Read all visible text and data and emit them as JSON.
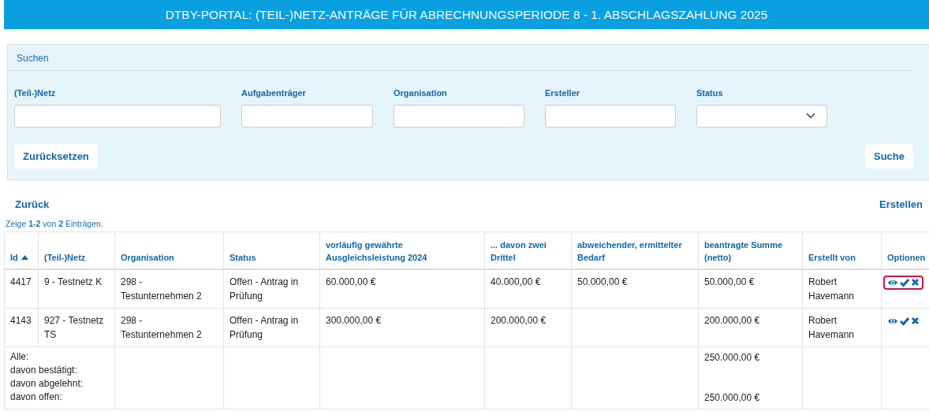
{
  "title": "DTBY-PORTAL: (TEIL-)NETZ-ANTRÄGE FÜR ABRECHNUNGSPERIODE 8 - 1. ABSCHLAGSZAHLUNG 2025",
  "search": {
    "heading": "Suchen",
    "fields": [
      {
        "label": "(Teil-)Netz",
        "dropdown": false
      },
      {
        "label": "Aufgabenträger",
        "dropdown": false
      },
      {
        "label": "Organisation",
        "dropdown": false
      },
      {
        "label": "Ersteller",
        "dropdown": false
      },
      {
        "label": "Status",
        "dropdown": true
      }
    ],
    "reset_button": "Zurücksetzen",
    "search_button": "Suche"
  },
  "back_link": "Zurück",
  "create_link": "Erstellen",
  "summary_text": "Zeige **1-2** von **2** Einträgen.",
  "table": {
    "columns": [
      {
        "label": "Id",
        "sorted_ascending": true
      },
      {
        "label": "(Teil-)Netz"
      },
      {
        "label": "Organisation"
      },
      {
        "label": "Status"
      },
      {
        "label": "vorläufig gewährte Ausgleichsleistung 2024"
      },
      {
        "label": "... davon zwei Drittel"
      },
      {
        "label": "abweichender, ermittelter Bedarf"
      },
      {
        "label": "beantragte Summe (netto)"
      },
      {
        "label": "Erstellt von"
      },
      {
        "label": "Optionen"
      }
    ],
    "rows": [
      {
        "cells": [
          "4417",
          "9 - Testnetz K",
          "298 - Testunternehmen 2",
          "Offen - Antrag in Prüfung",
          "60.000,00 €",
          "40.000,00 €",
          "50.000,00 €",
          "50.000,00 €",
          "Robert Havemann"
        ],
        "highlighted": true
      },
      {
        "cells": [
          "4143",
          "927 - Testnetz TS",
          "298 - Testunternehmen 2",
          "Offen - Antrag in Prüfung",
          "300.000,00 €",
          "200.000,00 €",
          null,
          "200.000,00 €",
          "Robert Havemann"
        ],
        "highlighted": false
      }
    ],
    "totals": [
      {
        "label": "Alle:",
        "value": "250.000,00 €"
      },
      {
        "label": "davon bestätigt:"
      },
      {
        "label": "davon abgelehnt:"
      },
      {
        "label": "davon offen:",
        "value": "250.000,00 €"
      }
    ]
  }
}
